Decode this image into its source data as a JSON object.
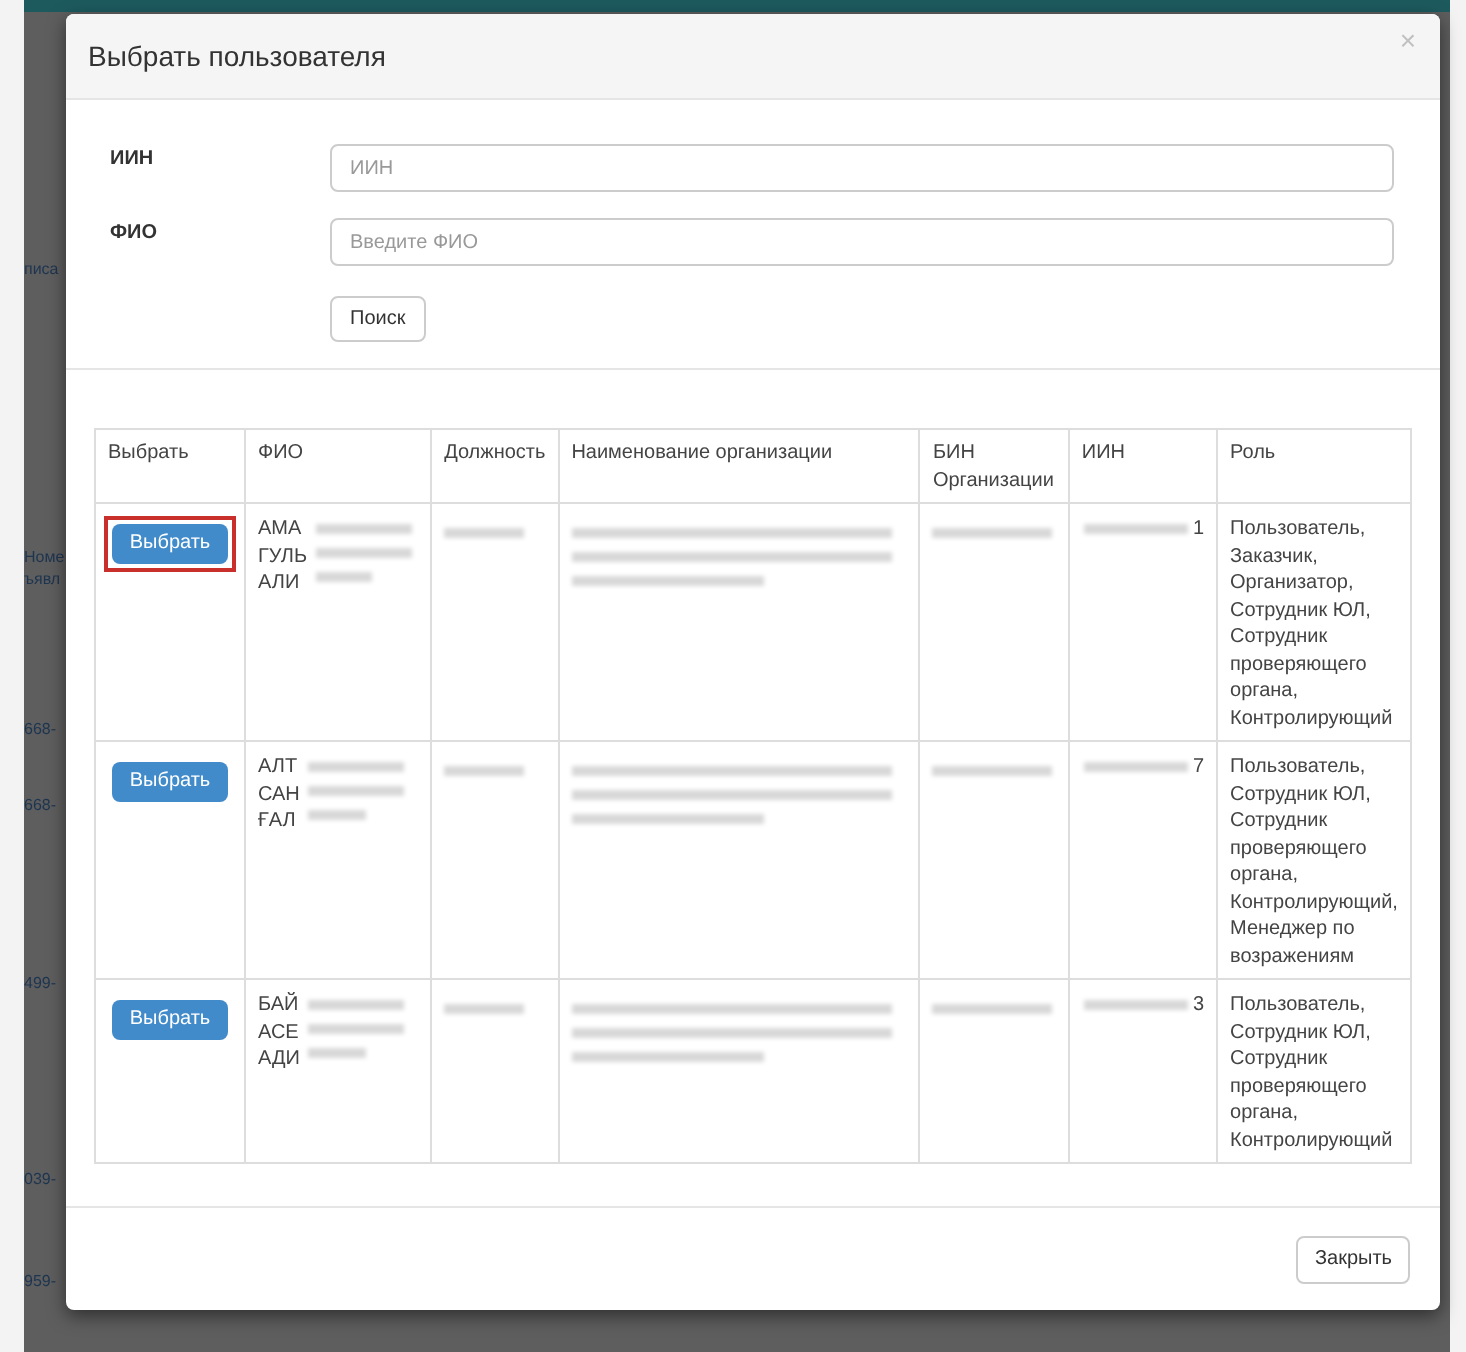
{
  "backdrop": {
    "fragments": [
      "писа",
      "Номе",
      "ъявл",
      "668-",
      "668-",
      "499-",
      "039-",
      "959-"
    ]
  },
  "dialog": {
    "title": "Выбрать пользователя",
    "close": "×",
    "form": {
      "fields": [
        {
          "label": "ИИН",
          "placeholder": "ИИН"
        },
        {
          "label": "ФИО",
          "placeholder": "Введите ФИО"
        }
      ],
      "search_button": "Поиск"
    },
    "table": {
      "columns": [
        "Выбрать",
        "ФИО",
        "Должность",
        "Наименование организации",
        "БИН Организации",
        "ИИН",
        "Роль"
      ],
      "rows": [
        {
          "button": "Выбрать",
          "highlighted": true,
          "fio": [
            "АМА",
            "ГУЛЬ",
            "АЛИ"
          ],
          "iin_tail": "1",
          "role": "Пользователь, Заказчик, Организатор, Сотрудник ЮЛ, Сотрудник проверяющего органа, Контролирующий"
        },
        {
          "button": "Выбрать",
          "highlighted": false,
          "fio": [
            "АЛТ",
            "САН",
            "ҒАЛ"
          ],
          "iin_tail": "7",
          "role": "Пользователь, Сотрудник ЮЛ, Сотрудник проверяющего органа, Контролирующий, Менеджер по возражениям"
        },
        {
          "button": "Выбрать",
          "highlighted": false,
          "fio": [
            "БАЙ",
            "АСЕ",
            "АДИ"
          ],
          "iin_tail": "3",
          "role": "Пользователь, Сотрудник ЮЛ, Сотрудник проверяющего органа, Контролирующий"
        }
      ]
    },
    "footer_button": "Закрыть"
  }
}
